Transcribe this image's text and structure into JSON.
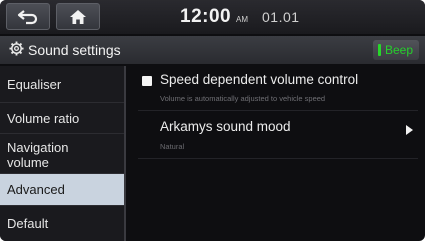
{
  "status_bar": {
    "time": "12:00",
    "ampm": "AM",
    "date": "01.01"
  },
  "header": {
    "title": "Sound settings",
    "beep_label": "Beep"
  },
  "sidebar": {
    "items": [
      {
        "label": "Equaliser"
      },
      {
        "label": "Volume ratio"
      },
      {
        "label": "Navigation volume"
      },
      {
        "label": "Advanced"
      },
      {
        "label": "Default"
      }
    ],
    "active": "Advanced"
  },
  "content": {
    "speed_volume": {
      "label": "Speed dependent volume control",
      "description": "Volume is automatically adjusted to vehicle speed",
      "checked": false
    },
    "arkamys": {
      "label": "Arkamys sound mood",
      "value": "Natural"
    }
  },
  "colors": {
    "background": "#0e0e11",
    "active_item": "#c9d3df",
    "beep_green": "#26cf2c"
  }
}
